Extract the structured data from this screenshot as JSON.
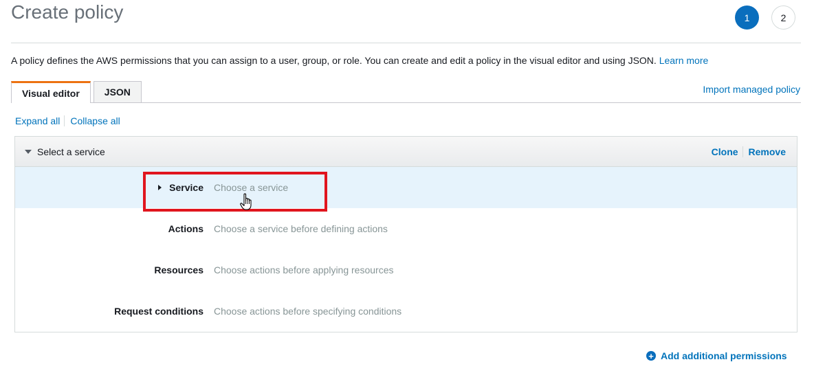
{
  "page": {
    "title": "Create policy",
    "intro_text": "A policy defines the AWS permissions that you can assign to a user, group, or role. You can create and edit a policy in the visual editor and using JSON.",
    "learn_more": "Learn more"
  },
  "steps": [
    "1",
    "2"
  ],
  "tabs": [
    {
      "label": "Visual editor",
      "active": true
    },
    {
      "label": "JSON",
      "active": false
    }
  ],
  "import_link": "Import managed policy",
  "expand_all": "Expand all",
  "collapse_all": "Collapse all",
  "panel": {
    "header": "Select a service",
    "clone": "Clone",
    "remove": "Remove",
    "rows": [
      {
        "label": "Service",
        "value": "Choose a service"
      },
      {
        "label": "Actions",
        "value": "Choose a service before defining actions"
      },
      {
        "label": "Resources",
        "value": "Choose actions before applying resources"
      },
      {
        "label": "Request conditions",
        "value": "Choose actions before specifying conditions"
      }
    ]
  },
  "add_permissions": "Add additional permissions",
  "colors": {
    "link": "#0073bb",
    "step_active": "#0a6ebd",
    "tab_accent": "#ec7211",
    "highlight_box": "#e0151e",
    "row_highlight": "#e6f3fc"
  },
  "icons": {
    "header_caret": "caret-down-icon",
    "service_caret": "caret-right-icon",
    "cursor": "hand-pointer-icon",
    "add": "plus-circle-icon"
  }
}
